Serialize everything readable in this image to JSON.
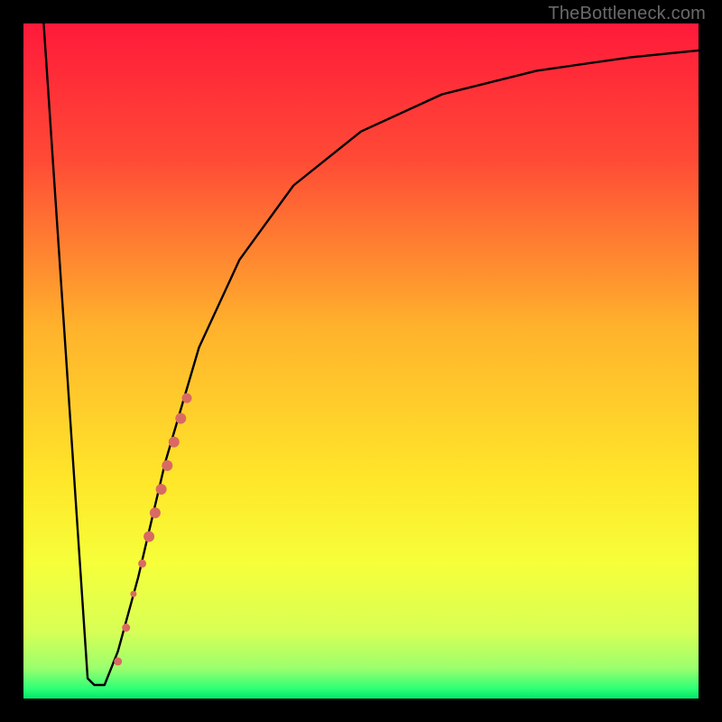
{
  "attribution": "TheBottleneck.com",
  "chart_data": {
    "type": "line",
    "title": "",
    "xlabel": "",
    "ylabel": "",
    "xlim": [
      0,
      100
    ],
    "ylim": [
      0,
      100
    ],
    "gradient_stops": [
      {
        "offset": 0.0,
        "color": "#ff1a3a"
      },
      {
        "offset": 0.2,
        "color": "#ff4a36"
      },
      {
        "offset": 0.45,
        "color": "#ffb22c"
      },
      {
        "offset": 0.68,
        "color": "#ffe72a"
      },
      {
        "offset": 0.8,
        "color": "#f6ff3a"
      },
      {
        "offset": 0.9,
        "color": "#d8ff55"
      },
      {
        "offset": 0.955,
        "color": "#9cff6d"
      },
      {
        "offset": 0.985,
        "color": "#2fff76"
      },
      {
        "offset": 1.0,
        "color": "#00e868"
      }
    ],
    "series": [
      {
        "name": "bottleneck-curve",
        "stroke": "#000000",
        "x": [
          3,
          9.5,
          10.5,
          12,
          14,
          17,
          21,
          26,
          32,
          40,
          50,
          62,
          76,
          90,
          100
        ],
        "y": [
          100,
          3,
          2,
          2,
          7,
          18,
          35,
          52,
          65,
          76,
          84,
          89.5,
          93,
          95,
          96
        ]
      }
    ],
    "markers": {
      "name": "highlighted-band",
      "color": "#d96a62",
      "points": [
        {
          "x": 14.0,
          "y": 5.5,
          "r": 4.5
        },
        {
          "x": 15.2,
          "y": 10.5,
          "r": 4.5
        },
        {
          "x": 16.3,
          "y": 15.5,
          "r": 3.5
        },
        {
          "x": 17.6,
          "y": 20.0,
          "r": 4.5
        },
        {
          "x": 18.6,
          "y": 24.0,
          "r": 6.0
        },
        {
          "x": 19.5,
          "y": 27.5,
          "r": 6.0
        },
        {
          "x": 20.4,
          "y": 31.0,
          "r": 6.0
        },
        {
          "x": 21.3,
          "y": 34.5,
          "r": 6.0
        },
        {
          "x": 22.3,
          "y": 38.0,
          "r": 6.0
        },
        {
          "x": 23.3,
          "y": 41.5,
          "r": 6.0
        },
        {
          "x": 24.2,
          "y": 44.5,
          "r": 5.5
        }
      ]
    }
  }
}
